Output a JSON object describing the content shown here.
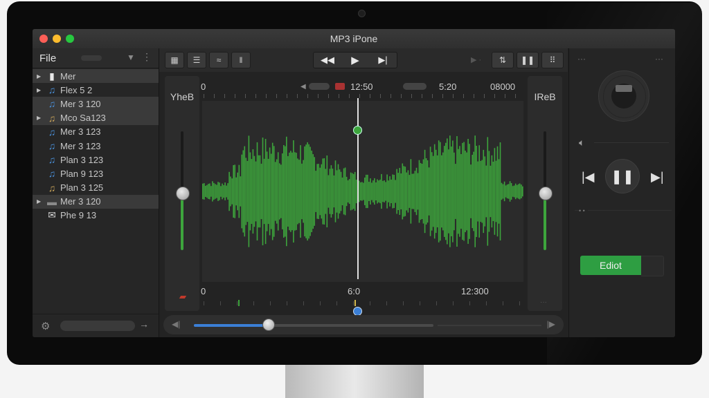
{
  "window": {
    "title": "MP3 iPone"
  },
  "colors": {
    "accent": "#3da53c",
    "edit_button": "#2e9e42",
    "scrubber": "#3b7fd6",
    "marker_red": "#c0392b"
  },
  "sidebar": {
    "title": "File",
    "files": [
      {
        "label": "Mer",
        "icon": "file-icon",
        "glyph": "▮",
        "color": "#e8e8e8",
        "arrow": "▶",
        "selected": true
      },
      {
        "label": "Flex 5 2",
        "icon": "music-note-icon",
        "glyph": "♫",
        "color": "#4a8fd8",
        "arrow": "▶",
        "selected": false
      },
      {
        "label": "Mer 3 120",
        "icon": "music-note-icon",
        "glyph": "♫",
        "color": "#4a8fd8",
        "arrow": "",
        "selected": true
      },
      {
        "label": "Mco Sa123",
        "icon": "music-note-icon",
        "glyph": "♫",
        "color": "#c9a35a",
        "arrow": "▶",
        "selected": true
      },
      {
        "label": "Mer 3 123",
        "icon": "music-note-icon",
        "glyph": "♫",
        "color": "#4a8fd8",
        "arrow": "",
        "selected": false
      },
      {
        "label": "Mer 3 123",
        "icon": "music-note-icon",
        "glyph": "♫",
        "color": "#4a8fd8",
        "arrow": "",
        "selected": false
      },
      {
        "label": "Plan 3 123",
        "icon": "music-note-icon",
        "glyph": "♫",
        "color": "#4a8fd8",
        "arrow": "",
        "selected": false
      },
      {
        "label": "Plan 9 123",
        "icon": "music-note-icon",
        "glyph": "♫",
        "color": "#4a8fd8",
        "arrow": "",
        "selected": false
      },
      {
        "label": "Plan 3 125",
        "icon": "music-note-icon",
        "glyph": "♫",
        "color": "#c9a35a",
        "arrow": "",
        "selected": false
      },
      {
        "label": "Mer 3 120",
        "icon": "folder-icon",
        "glyph": "▬",
        "color": "#8a8a8a",
        "arrow": "▶",
        "selected": true
      },
      {
        "label": "Phe 9 13",
        "icon": "mail-icon",
        "glyph": "✉",
        "color": "#d8d8d8",
        "arrow": "",
        "selected": false
      }
    ]
  },
  "toolbar": {
    "view_icons": [
      "grid-view-icon",
      "list-view-icon",
      "wave-view-icon",
      "split-view-icon"
    ],
    "transport": [
      "rewind-icon",
      "play-icon",
      "skip-forward-icon"
    ],
    "right_icons": [
      "shuffle-icon",
      "pause-icon",
      "grid-icon"
    ]
  },
  "editor": {
    "left_track_label": "YheB",
    "right_track_label": "IReB",
    "left_level": 0.48,
    "right_level": 0.48,
    "ruler_top": {
      "start": "0",
      "mid": "12:50",
      "mark2": "5:20",
      "end": "08000"
    },
    "ruler_bottom": {
      "start": "0",
      "mid": "6:0",
      "end": "12:300"
    },
    "playhead_fraction": 0.5,
    "progress": 0.31
  },
  "right_panel": {
    "edit_label": "Ediot"
  }
}
